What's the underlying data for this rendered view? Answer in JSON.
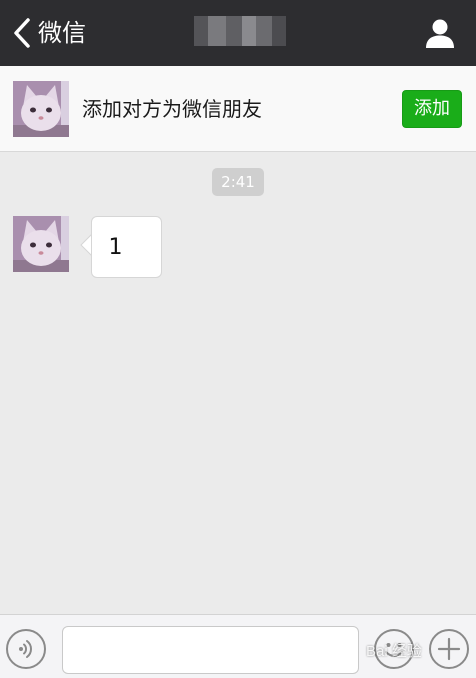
{
  "header": {
    "back_label": "微信",
    "back_icon": "chevron-left-icon",
    "title": "",
    "profile_icon": "person-icon",
    "background_color": "#2d2d30"
  },
  "banner": {
    "text": "添加对方为微信朋友",
    "add_label": "添加",
    "add_color": "#1aad19"
  },
  "chat": {
    "timestamp": "2:41",
    "messages": [
      {
        "sender": "other",
        "text": "1"
      }
    ]
  },
  "inputbar": {
    "text_value": "",
    "voice_icon": "voice-icon",
    "emoji_icon": "emoji-icon",
    "plus_icon": "plus-icon"
  },
  "watermark": {
    "text": "Bai 经验"
  }
}
